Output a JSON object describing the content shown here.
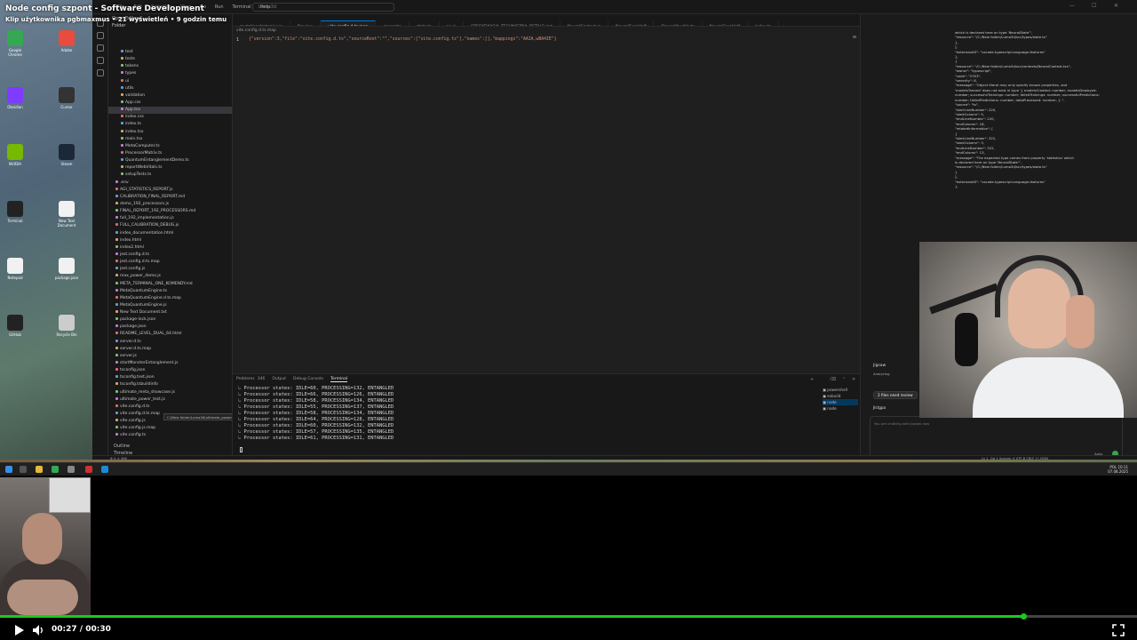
{
  "video": {
    "title": "Node config szpont - Software Development",
    "subtitle": "Klip użytkownika pgbmaxmus • 21 wyświetleń • 9 godzin temu",
    "time": "00:27 / 00:30",
    "progress": 0.9
  },
  "editor": {
    "menu": [
      "File",
      "Edit",
      "Selection",
      "View",
      "Go",
      "Run",
      "Terminal",
      "Help"
    ],
    "command_center": "Luma3d",
    "tabs": [
      {
        "label": "mutationstrategies.js",
        "active": false
      },
      {
        "label": "Preview",
        "active": false
      },
      {
        "label": "vite.config.d.ts.map",
        "active": true
      },
      {
        "label": "generate",
        "active": false
      },
      {
        "label": "state.ts",
        "active": false
      },
      {
        "label": "ap.js",
        "active": false
      },
      {
        "label": "SPECYFIKACJA_TECHNICZNA_DETALE.md",
        "active": false
      },
      {
        "label": "NeuralContext.js",
        "active": false
      },
      {
        "label": "NeuralCoreHalf",
        "active": false
      },
      {
        "label": "Qquantityutils.ts",
        "active": false
      },
      {
        "label": "NeuralCoreHalf",
        "active": false
      },
      {
        "label": "index.ts",
        "active": false
      }
    ],
    "breadcrumb": "vite.config.d.ts.map",
    "line_number": "1",
    "code": "{\"version\":3,\"file\":\"vite.config.d.ts\",\"sourceRoot\":\"\",\"sources\":[\"vite.config.ts\"],\"names\":[],\"mappings\":\"AAIA,wBA4IE\"}"
  },
  "explorer": {
    "header": "Open Editors",
    "folder": "Folder",
    "items": [
      "test",
      "tests",
      "tokens",
      "types",
      "ui",
      "utils",
      "validation",
      "App.css",
      "App.tsx",
      "index.css",
      "index.ts",
      "index.tsx",
      "main.tsx",
      "MetaComputer.ts",
      "ProcessorMatrix.ts",
      "QuantumEntanglementDemo.ts",
      "reportWebVitals.ts",
      "setupTests.ts",
      ".env",
      "AGI_STATISTICS_REPORT.js",
      "CALIBRATION_FINAL_REPORT.md",
      "demo_192_processors.js",
      "FINAL_REPORT_192_PROCESSORS.md",
      "full_192_implementation.js",
      "FULL_CALIBRATION_DEBUG.js",
      "index_documentation.html",
      "index.html",
      "index2.html",
      "jest.config.d.ts",
      "jest.config.d.ts.map",
      "jest.config.js",
      "max_power_demo.js",
      "META_TERMINAL_ONE_KOMENDY.md",
      "MetaQuantumEngine.ts",
      "MetaQuantumEngine.d.ts.map",
      "MetaQuantumEngine.js",
      "New Text Document.txt",
      "package-lock.json",
      "package.json",
      "README_LEVEL_DUAL_64.html",
      "server.d.ts",
      "server.d.ts.map",
      "server.js",
      "startMonsterEntanglement.js",
      "tsconfig.json",
      "tsconfig.test.json",
      "tsconfig.tsbuildinfo",
      "ultimate_meta_showcase.js",
      "ultimate_power_test.js",
      "vite.config.d.ts",
      "vite.config.d.ts.map",
      "vite.config.js",
      "vite.config.js.map",
      "vite.config.ts"
    ],
    "hover_tooltip": "C:\\New folder\\Luma3d\\ultimate_power_test.js",
    "outline": "Outline",
    "timeline": "Timeline"
  },
  "panel": {
    "tabs": [
      {
        "label": "Problems",
        "badge": "346",
        "active": false
      },
      {
        "label": "Output",
        "badge": "",
        "active": false
      },
      {
        "label": "Debug Console",
        "badge": "",
        "active": false
      },
      {
        "label": "Terminal",
        "badge": "",
        "active": true
      }
    ],
    "terminal_lines": [
      "Processor states: IDLE=60, PROCESSING=132, ENTANGLED",
      "Processor states: IDLE=66, PROCESSING=126, ENTANGLED",
      "Processor states: IDLE=58, PROCESSING=134, ENTANGLED",
      "Processor states: IDLE=55, PROCESSING=137, ENTANGLED",
      "Processor states: IDLE=58, PROCESSING=134, ENTANGLED",
      "Processor states: IDLE=64, PROCESSING=128, ENTANGLED",
      "Processor states: IDLE=60, PROCESSING=132, ENTANGLED",
      "Processor states: IDLE=57, PROCESSING=135, ENTANGLED",
      "Processor states: IDLE=61, PROCESSING=131, ENTANGLED"
    ],
    "terminals": [
      "powershell",
      "esbuild",
      "node",
      "node"
    ]
  },
  "side_panel": {
    "log_lines": [
      "which is declared here on type 'NeuralState'\",",
      "\"resource\": \"/C:/New folder/Luma3d/src/types/state.ts\"",
      "},",
      "],",
      "\"extensionID\": \"vscode.typescript-language-features\"",
      "},",
      "{",
      "\"resource\": \"/C:/New folder/Luma3d/src/contexts/NeuralContext.tsx\",",
      "\"owner\": \"typescript\",",
      "\"code\": \"2353\",",
      "\"severity\": 8,",
      "\"message\": \"Object literal may only specify known properties, and",
      "'modelsTrained' does not exist in type '{ modelsCreated: number; modelsDeployed:",
      "number; successfulTrainings: number; failedTrainings: number; successfulPredictions:",
      "number; failedPredictions: number; dataProcessed: number; }'.\",",
      "\"source\": \"ts\",",
      "\"startLineNumber\": 220,",
      "\"startColumn\": 5,",
      "\"endLineNumber\": 220,",
      "\"endColumn\": 18,",
      "\"relatedInformation\": [",
      "{",
      "\"startLineNumber\": 322,",
      "\"startColumn\": 3,",
      "\"endLineNumber\": 322,",
      "\"endColumn\": 13,",
      "\"message\": \"The expected type comes from property 'statistics' which",
      "is declared here on type 'NeuralState'\",",
      "\"resource\": \"/C:/New folder/Luma3d/src/types/state.ts\"",
      "}",
      "],",
      "\"extensionID\": \"vscode.typescript-language-features\"",
      "},"
    ],
    "chat_agent": "Jigsaw",
    "chat_status": "Analyzing",
    "review_button": "2 files need review",
    "agent_name": "Jlstgpa",
    "placeholder": "You are chatting with Jigsaw now",
    "model": "Auto"
  },
  "statusbar": {
    "left": "⊗ 0 ⚠ 346",
    "right": "Ln 1, Col 1  Spaces: 4  UTF-8  CRLF  {} JSON"
  },
  "taskbar": {
    "clock": "10:11",
    "date": "07.08.2025",
    "lang": "POL"
  },
  "desktop": {
    "icons": [
      "Google Chrome",
      "Adobe",
      "Obsidian",
      "Cursor",
      "NVIDIA",
      "Steam",
      "Terminal",
      "New Text Document",
      "Notepad",
      "package.json",
      "GitHub",
      "Recycle Bin"
    ]
  },
  "colors": {
    "accent": "#0078d4",
    "progress": "#1ec71e",
    "terminal_text": "#d4d4d4"
  }
}
